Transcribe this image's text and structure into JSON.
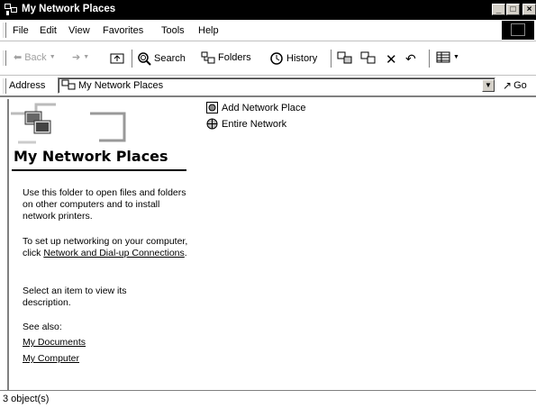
{
  "window": {
    "title": "My Network Places",
    "controls": [
      "_",
      "□",
      "×"
    ]
  },
  "menu": [
    "File",
    "Edit",
    "View",
    "Favorites",
    "Tools",
    "Help"
  ],
  "toolbar": {
    "back": "Back",
    "search": "Search",
    "folders": "Folders",
    "history": "History"
  },
  "address": {
    "label": "Address",
    "value": "My Network Places",
    "go": "Go"
  },
  "left_pane": {
    "heading": "My Network Places",
    "paragraph1": "Use this folder to open files and folders on other computers and to install network printers.",
    "paragraph2_prefix": "To set up networking on your computer, click ",
    "paragraph2_link": "Network and Dial-up Connections",
    "paragraph2_suffix": ".",
    "paragraph3": "Select an item to view its description.",
    "see_also": "See also:",
    "links": [
      "My Documents",
      "My Computer"
    ]
  },
  "items": [
    "Add Network Place",
    "Entire Network"
  ],
  "status": "3 object(s)"
}
